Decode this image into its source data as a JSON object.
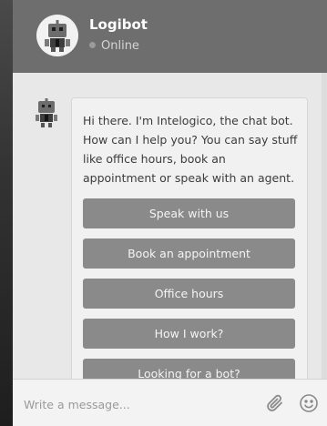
{
  "header": {
    "bot_name": "Logibot",
    "status": "Online"
  },
  "conversation": {
    "message": "Hi there. I'm Intelogico, the chat bot. How can I help you? You can say stuff like office hours, book an appointment or speak with an agent.",
    "options": [
      "Speak with us",
      "Book an appointment",
      "Office hours",
      "How I work?",
      "Looking for a bot?"
    ]
  },
  "composer": {
    "placeholder": "Write a message..."
  },
  "icons": {
    "header_avatar": "robot-avatar-icon",
    "message_avatar": "robot-avatar-icon",
    "attach": "paperclip-icon",
    "emoji": "smiley-icon",
    "status": "online-dot-icon"
  }
}
